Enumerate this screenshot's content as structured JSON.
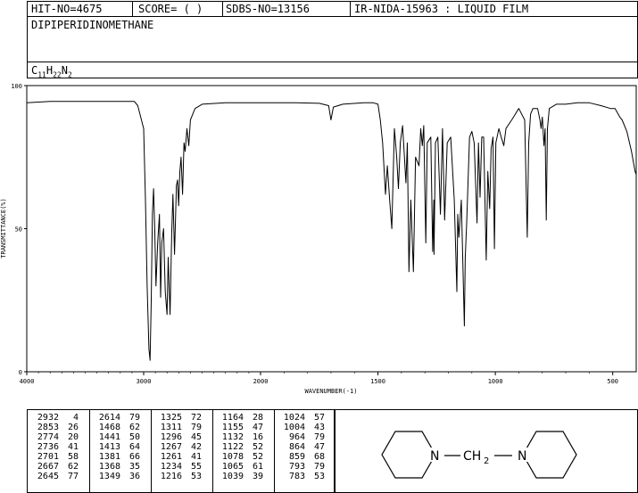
{
  "header": {
    "hit_no": "HIT-NO=4675",
    "score": "SCORE=  (   )",
    "sdbs_no": "SDBS-NO=13156",
    "ir_info": "IR-NIDA-15963 : LIQUID FILM"
  },
  "compound": {
    "name": "DIPIPERIDINOMETHANE",
    "formula_parts": [
      "C",
      "11",
      "H",
      "22",
      "N",
      "2"
    ]
  },
  "chart_data": {
    "type": "line",
    "title": "",
    "xlabel": "WAVENUMBER(-1)",
    "ylabel": "TRANSMITTANCE(%)",
    "xlim": [
      4000,
      400
    ],
    "ylim": [
      0,
      100
    ],
    "x_ticks": [
      4000,
      3000,
      2000,
      1500,
      1000,
      500
    ],
    "y_ticks": [
      0,
      50,
      100
    ],
    "x_tick_labels": [
      "4000",
      "3000",
      "2000",
      "1500",
      "1000",
      "500"
    ],
    "y_tick_labels": [
      "0",
      "50",
      "100"
    ],
    "grid": false,
    "spectrum": [
      [
        4000,
        94
      ],
      [
        3800,
        94.5
      ],
      [
        3500,
        94.5
      ],
      [
        3200,
        94.5
      ],
      [
        3080,
        94.5
      ],
      [
        3050,
        93
      ],
      [
        3000,
        85
      ],
      [
        2985,
        60
      ],
      [
        2970,
        30
      ],
      [
        2955,
        8
      ],
      [
        2945,
        4
      ],
      [
        2935,
        25
      ],
      [
        2925,
        55
      ],
      [
        2915,
        64
      ],
      [
        2905,
        50
      ],
      [
        2895,
        30
      ],
      [
        2880,
        45
      ],
      [
        2865,
        55
      ],
      [
        2855,
        26
      ],
      [
        2845,
        45
      ],
      [
        2830,
        50
      ],
      [
        2815,
        28
      ],
      [
        2800,
        20
      ],
      [
        2790,
        40
      ],
      [
        2774,
        20
      ],
      [
        2760,
        48
      ],
      [
        2750,
        62
      ],
      [
        2736,
        41
      ],
      [
        2720,
        65
      ],
      [
        2710,
        67
      ],
      [
        2701,
        58
      ],
      [
        2690,
        70
      ],
      [
        2680,
        75
      ],
      [
        2667,
        62
      ],
      [
        2655,
        80
      ],
      [
        2645,
        77
      ],
      [
        2630,
        85
      ],
      [
        2614,
        79
      ],
      [
        2600,
        88
      ],
      [
        2560,
        92
      ],
      [
        2500,
        93.5
      ],
      [
        2300,
        94
      ],
      [
        2000,
        94
      ],
      [
        1850,
        94
      ],
      [
        1750,
        93.8
      ],
      [
        1710,
        93
      ],
      [
        1700,
        88
      ],
      [
        1690,
        92.5
      ],
      [
        1650,
        93.5
      ],
      [
        1560,
        94
      ],
      [
        1520,
        94
      ],
      [
        1500,
        93.5
      ],
      [
        1490,
        88
      ],
      [
        1480,
        80
      ],
      [
        1468,
        62
      ],
      [
        1460,
        72
      ],
      [
        1450,
        60
      ],
      [
        1441,
        50
      ],
      [
        1430,
        85
      ],
      [
        1420,
        75
      ],
      [
        1413,
        64
      ],
      [
        1405,
        80
      ],
      [
        1395,
        86
      ],
      [
        1381,
        66
      ],
      [
        1375,
        80
      ],
      [
        1368,
        35
      ],
      [
        1360,
        60
      ],
      [
        1349,
        35
      ],
      [
        1340,
        75
      ],
      [
        1325,
        72
      ],
      [
        1318,
        85
      ],
      [
        1311,
        79
      ],
      [
        1305,
        86
      ],
      [
        1296,
        45
      ],
      [
        1290,
        80
      ],
      [
        1275,
        82
      ],
      [
        1267,
        42
      ],
      [
        1262,
        60
      ],
      [
        1261,
        41
      ],
      [
        1255,
        80
      ],
      [
        1245,
        82
      ],
      [
        1234,
        55
      ],
      [
        1225,
        85
      ],
      [
        1216,
        53
      ],
      [
        1205,
        80
      ],
      [
        1190,
        82
      ],
      [
        1175,
        60
      ],
      [
        1164,
        28
      ],
      [
        1160,
        55
      ],
      [
        1155,
        47
      ],
      [
        1145,
        60
      ],
      [
        1132,
        16
      ],
      [
        1128,
        40
      ],
      [
        1122,
        52
      ],
      [
        1110,
        82
      ],
      [
        1100,
        84
      ],
      [
        1090,
        80
      ],
      [
        1078,
        52
      ],
      [
        1072,
        80
      ],
      [
        1065,
        61
      ],
      [
        1058,
        82
      ],
      [
        1050,
        82
      ],
      [
        1039,
        39
      ],
      [
        1032,
        70
      ],
      [
        1024,
        57
      ],
      [
        1018,
        78
      ],
      [
        1010,
        82
      ],
      [
        1004,
        43
      ],
      [
        998,
        80
      ],
      [
        985,
        85
      ],
      [
        975,
        82
      ],
      [
        964,
        79
      ],
      [
        955,
        85
      ],
      [
        930,
        88
      ],
      [
        900,
        92
      ],
      [
        875,
        88
      ],
      [
        864,
        47
      ],
      [
        858,
        80
      ],
      [
        850,
        90
      ],
      [
        840,
        92
      ],
      [
        820,
        92
      ],
      [
        810,
        88
      ],
      [
        805,
        85
      ],
      [
        800,
        89
      ],
      [
        793,
        79
      ],
      [
        788,
        85
      ],
      [
        783,
        53
      ],
      [
        778,
        85
      ],
      [
        770,
        92
      ],
      [
        740,
        93.5
      ],
      [
        700,
        93.5
      ],
      [
        650,
        94
      ],
      [
        600,
        94
      ],
      [
        550,
        93
      ],
      [
        510,
        92
      ],
      [
        490,
        92
      ],
      [
        470,
        89
      ],
      [
        460,
        88
      ],
      [
        440,
        84
      ],
      [
        420,
        77
      ],
      [
        405,
        70
      ],
      [
        400,
        69
      ]
    ]
  },
  "peaks": {
    "columns": [
      [
        [
          "2932",
          "4"
        ],
        [
          "2853",
          "26"
        ],
        [
          "2774",
          "20"
        ],
        [
          "2736",
          "41"
        ],
        [
          "2701",
          "58"
        ],
        [
          "2667",
          "62"
        ],
        [
          "2645",
          "77"
        ]
      ],
      [
        [
          "2614",
          "79"
        ],
        [
          "1468",
          "62"
        ],
        [
          "1441",
          "50"
        ],
        [
          "1413",
          "64"
        ],
        [
          "1381",
          "66"
        ],
        [
          "1368",
          "35"
        ],
        [
          "1349",
          "36"
        ]
      ],
      [
        [
          "1325",
          "72"
        ],
        [
          "1311",
          "79"
        ],
        [
          "1296",
          "45"
        ],
        [
          "1267",
          "42"
        ],
        [
          "1261",
          "41"
        ],
        [
          "1234",
          "55"
        ],
        [
          "1216",
          "53"
        ]
      ],
      [
        [
          "1164",
          "28"
        ],
        [
          "1155",
          "47"
        ],
        [
          "1132",
          "16"
        ],
        [
          "1122",
          "52"
        ],
        [
          "1078",
          "52"
        ],
        [
          "1065",
          "61"
        ],
        [
          "1039",
          "39"
        ]
      ],
      [
        [
          "1024",
          "57"
        ],
        [
          "1004",
          "43"
        ],
        [
          "964",
          "79"
        ],
        [
          "864",
          "47"
        ],
        [
          "859",
          "68"
        ],
        [
          "793",
          "79"
        ],
        [
          "783",
          "53"
        ]
      ]
    ]
  },
  "structure": {
    "n_left": "N",
    "ch2_main": "CH",
    "ch2_sub": "2",
    "n_right": "N"
  }
}
